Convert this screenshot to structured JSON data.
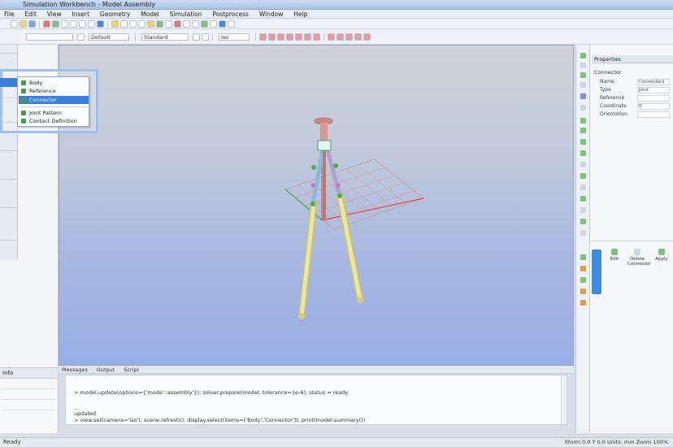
{
  "window": {
    "title": "Simulation Workbench - Model Assembly"
  },
  "menu": [
    {
      "label": "File"
    },
    {
      "label": "Edit"
    },
    {
      "label": "View"
    },
    {
      "label": "Insert"
    },
    {
      "label": "Geometry"
    },
    {
      "label": "Model"
    },
    {
      "label": "Simulation"
    },
    {
      "label": "Postprocess"
    },
    {
      "label": "Window"
    },
    {
      "label": "Help"
    }
  ],
  "toolbar2": {
    "combo1": "Default",
    "combo2": "Standard",
    "combo3": "Iso"
  },
  "popup": {
    "items": [
      {
        "label": "Body"
      },
      {
        "label": "Reference"
      },
      {
        "label": "Connector"
      },
      {
        "label": "Joint Pattern"
      },
      {
        "label": "Contact Definition"
      }
    ]
  },
  "left_bottom": {
    "header": "Info"
  },
  "console": {
    "tabs": [
      {
        "label": "Messages"
      },
      {
        "label": "Output"
      },
      {
        "label": "Script"
      }
    ],
    "lines": [
      "> model.update(options={'mode':'assembly'}); solver.prepare(model, tolerance=1e-6); status = ready",
      "  ...",
      "  updated",
      "> view.set(camera='iso'); scene.refresh(); display.select(items=['Body','Connector']); print(model.summary())"
    ]
  },
  "properties": {
    "header": "Properties",
    "title": "Connector",
    "rows": [
      {
        "label": "Name",
        "value": "Connector1"
      },
      {
        "label": "Type",
        "value": "Joint"
      },
      {
        "label": "Reference",
        "value": ""
      },
      {
        "label": "Coordinate",
        "value": "0"
      },
      {
        "label": "Orientation",
        "value": ""
      }
    ],
    "actions": [
      {
        "label": "Edit"
      },
      {
        "label": "Delete Connector"
      },
      {
        "label": "Apply"
      }
    ]
  },
  "status": {
    "left": "Ready",
    "right": "Xform 0.0  Y 0.0  Units: mm  Zoom 100%"
  },
  "colors": {
    "accent": "#3c7fd8",
    "leg": "#e6e08c",
    "frame_red": "#d98080",
    "frame_green": "#6cc26c",
    "head": "#c98a84"
  }
}
